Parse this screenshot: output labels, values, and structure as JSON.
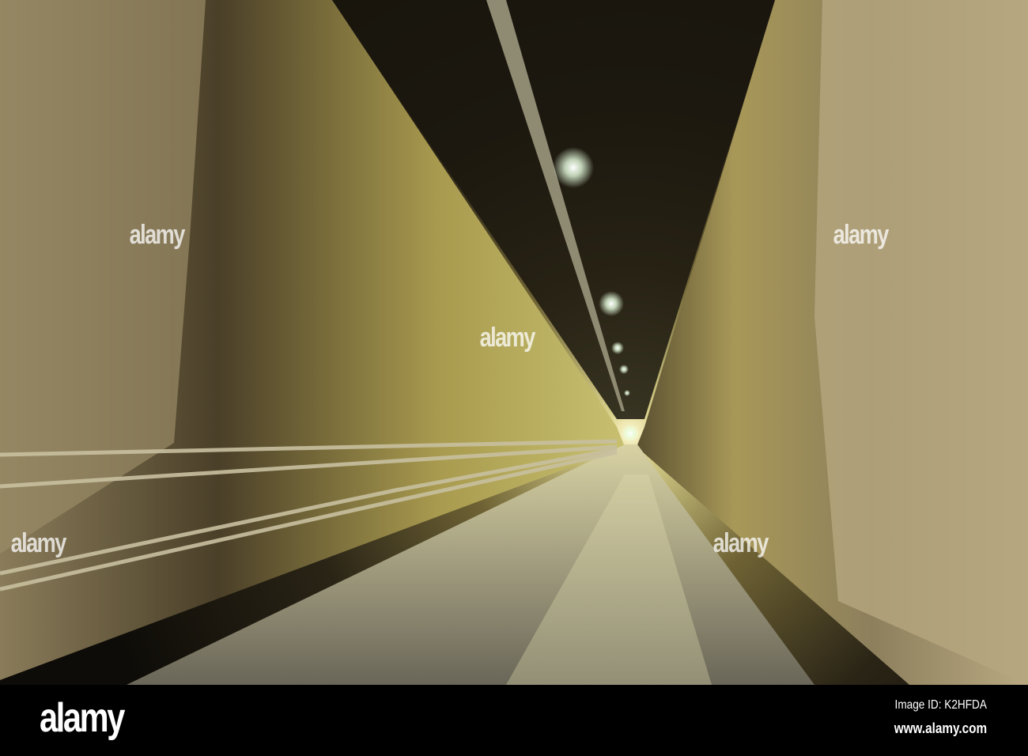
{
  "photo": {
    "subject": "rock tunnel with road and ceiling lights"
  },
  "watermark": {
    "text": "alamy"
  },
  "footer": {
    "logo": "alamy",
    "image_id": "Image ID: K2HFDA",
    "website": "www.alamy.com"
  },
  "colors": {
    "rock_light": "#c9b98a",
    "rock_dark": "#3a3222",
    "road": "#8a8570",
    "footer_bg": "#000000"
  }
}
